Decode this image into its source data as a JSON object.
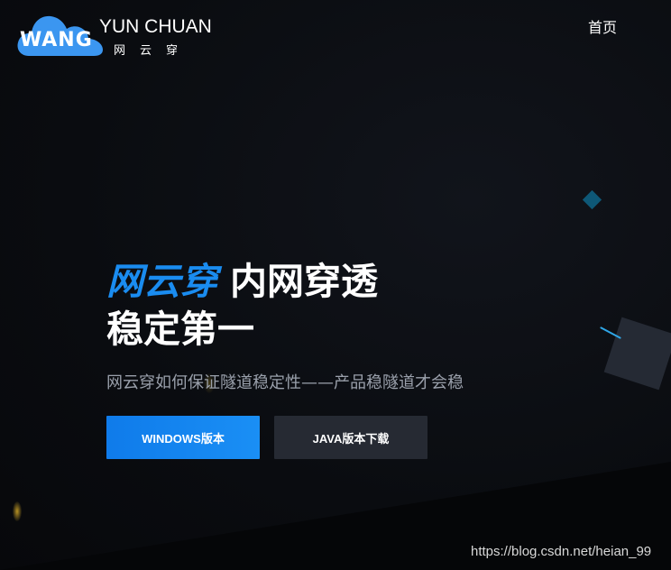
{
  "header": {
    "logo": {
      "mark_text": "WANG",
      "brand_text": "YUN CHUAN",
      "brand_cn": "网云穿",
      "cloud_color": "#3b96f0"
    },
    "nav": {
      "home_label": "首页"
    }
  },
  "hero": {
    "title_accent": "网云穿",
    "title_rest": "内网穿透",
    "title_line2": "稳定第一",
    "subtitle": "网云穿如何保证隧道稳定性——产品稳隧道才会稳",
    "accent_color": "#1a8cf0"
  },
  "buttons": {
    "windows_label": "WINDOWS版本",
    "java_label": "JAVA版本下载"
  },
  "watermark": {
    "text": "https://blog.csdn.net/heian_99"
  },
  "colors": {
    "background": "#0b0d12",
    "primary_button": "#1482ee",
    "secondary_button": "#262a33",
    "subtitle_text": "#9aa0ab"
  }
}
